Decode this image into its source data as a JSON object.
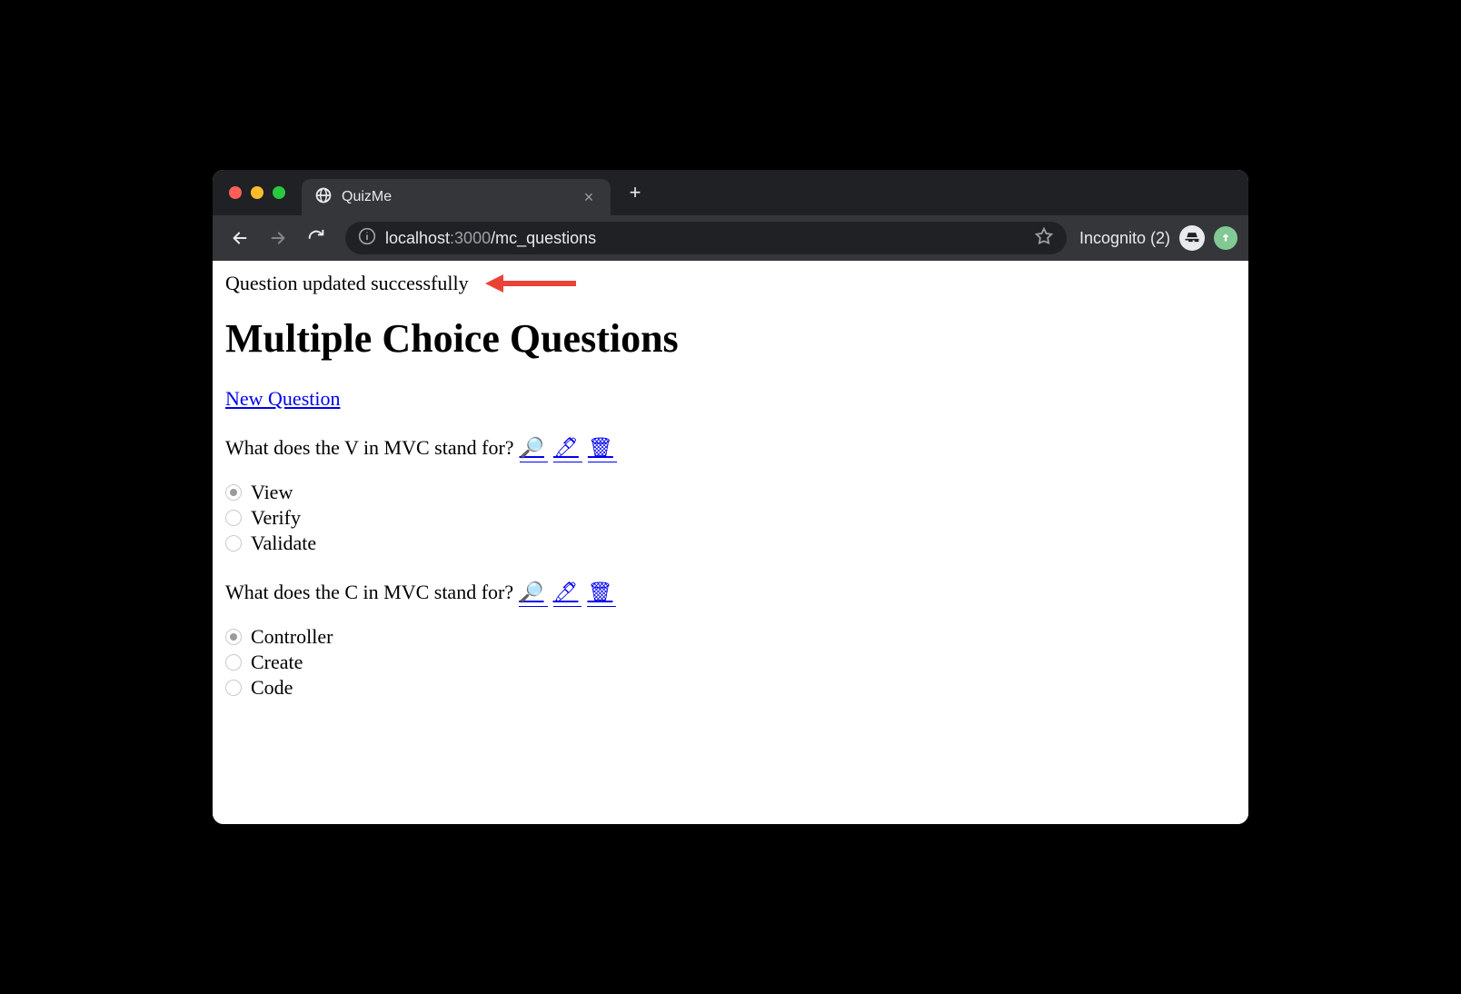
{
  "browser": {
    "tab_title": "QuizMe",
    "url_host": "localhost",
    "url_port": ":3000",
    "url_path": "/mc_questions",
    "incognito_label": "Incognito (2)"
  },
  "page": {
    "flash_message": "Question updated successfully",
    "heading": "Multiple Choice Questions",
    "new_link": "New Question",
    "action_icons": {
      "show": "🔎",
      "edit": "🖊",
      "delete": "🗑"
    },
    "questions": [
      {
        "text": "What does the V in MVC stand for?",
        "options": [
          "View",
          "Verify",
          "Validate"
        ],
        "selected": 0
      },
      {
        "text": "What does the C in MVC stand for?",
        "options": [
          "Controller",
          "Create",
          "Code"
        ],
        "selected": 0
      }
    ]
  },
  "colors": {
    "arrow": "#ea4335"
  }
}
